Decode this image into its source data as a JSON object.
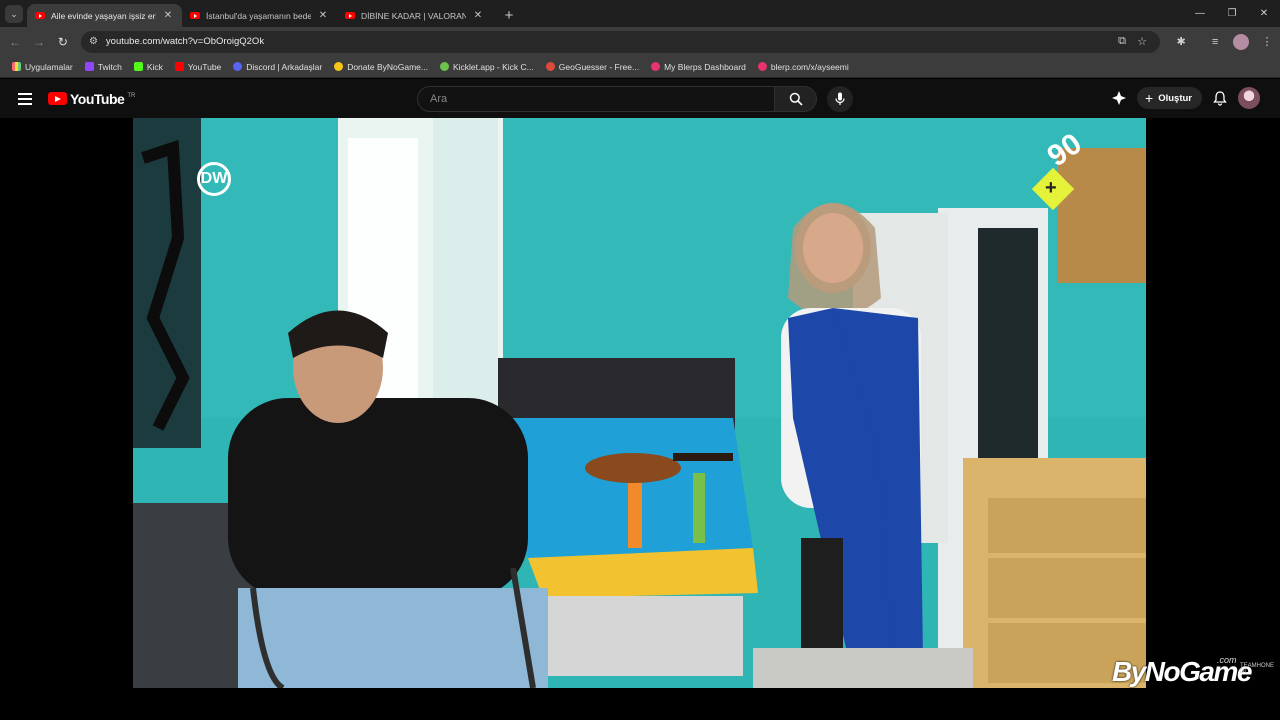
{
  "browser": {
    "tabs": [
      {
        "title": "Aile evinde yaşayan işsiz erkek: Türk",
        "active": true
      },
      {
        "title": "İstanbul'da yaşamanın bedeli: \"Ma",
        "active": false
      },
      {
        "title": "DİBİNE KADAR | VALORANT ED",
        "active": false
      }
    ],
    "address": "youtube.com/watch?v=ObOroigQ2Ok",
    "bookmarks": [
      {
        "label": "Uygulamalar",
        "color": "#c8c8c8"
      },
      {
        "label": "Twitch",
        "color": "#9146ff"
      },
      {
        "label": "Kick",
        "color": "#53fc18"
      },
      {
        "label": "YouTube",
        "color": "#ff0000"
      },
      {
        "label": "Discord | Arkadaşlar",
        "color": "#5865f2"
      },
      {
        "label": "Donate ByNoGame...",
        "color": "#f5c518"
      },
      {
        "label": "Kicklet.app - Kick C...",
        "color": "#6cc24a"
      },
      {
        "label": "GeoGuesser - Free...",
        "color": "#e04a3a"
      },
      {
        "label": "My Blerps Dashboard",
        "color": "#e8336d"
      },
      {
        "label": "blerp.com/x/ayseemi",
        "color": "#e8336d"
      }
    ]
  },
  "youtube": {
    "logo_text": "YouTube",
    "logo_country": "TR",
    "search_placeholder": "Ara",
    "create_label": "Oluştur"
  },
  "video": {
    "channel_logo": "DW",
    "corner_badge_plus": "+",
    "corner_badge_number": "90"
  },
  "overlay": {
    "watermark": "ByNoGame",
    "watermark_suffix": ".com",
    "watermark_small": "TEAMHONE DL"
  },
  "colors": {
    "yt_red": "#ff0000",
    "badge_yellow": "#e5f23a",
    "wall_teal": "#2cb3b0"
  }
}
